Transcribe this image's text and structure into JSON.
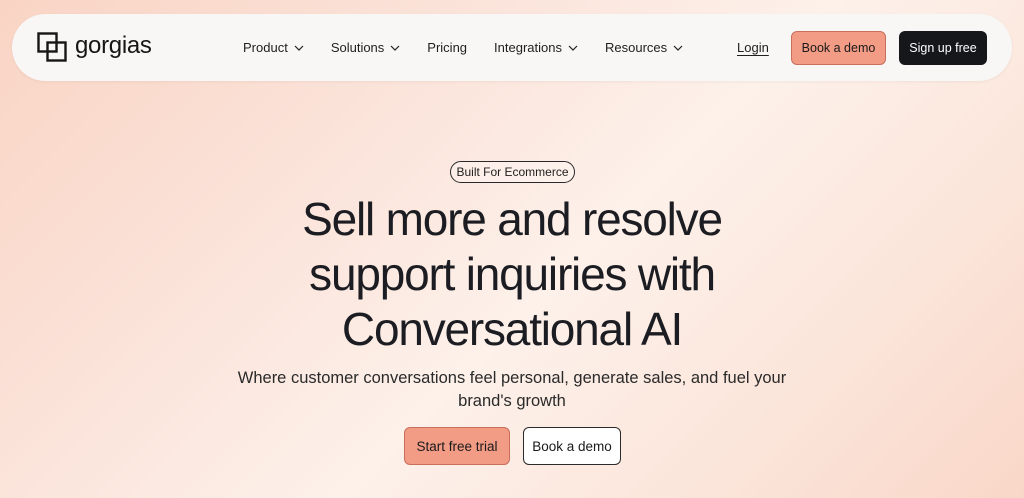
{
  "brand": {
    "name": "gorgias",
    "logo_icon": "gorgias-logo-icon"
  },
  "nav": {
    "items": [
      {
        "label": "Product",
        "has_dropdown": true
      },
      {
        "label": "Solutions",
        "has_dropdown": true
      },
      {
        "label": "Pricing",
        "has_dropdown": false
      },
      {
        "label": "Integrations",
        "has_dropdown": true
      },
      {
        "label": "Resources",
        "has_dropdown": true
      }
    ],
    "login_label": "Login",
    "book_demo_label": "Book a demo",
    "signup_label": "Sign up free"
  },
  "hero": {
    "badge": "Built For Ecommerce",
    "headline_line1": "Sell more and resolve",
    "headline_line2": "support inquiries with",
    "headline_line3": "Conversational AI",
    "subheadline": "Where customer conversations feel personal, generate sales, and fuel your brand's growth",
    "primary_cta": "Start free trial",
    "secondary_cta": "Book a demo"
  },
  "colors": {
    "accent": "#f29b85",
    "dark": "#16171b",
    "background_peach": "#f9d4c4"
  }
}
